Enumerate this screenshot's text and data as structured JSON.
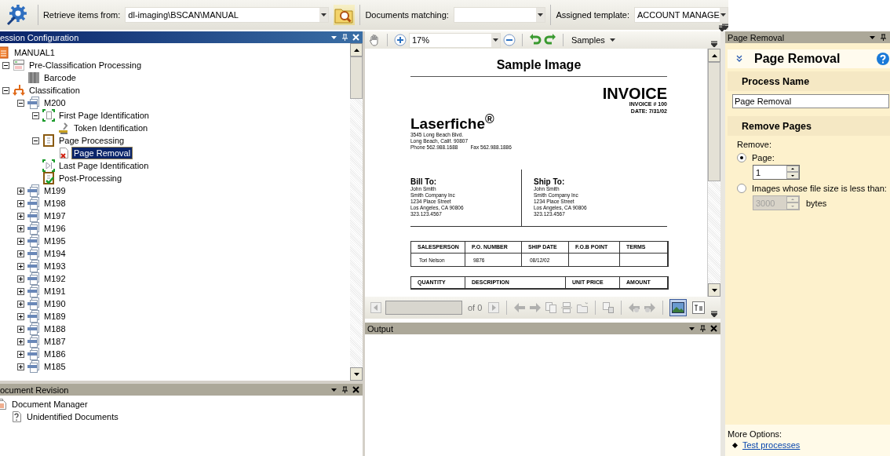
{
  "toolbar": {
    "retrieve_label": "Retrieve items from:",
    "retrieve_value": "dl-imaging\\BSCAN\\MANUAL",
    "matching_label": "Documents matching:",
    "template_label": "Assigned template:",
    "template_value": "ACCOUNT MANAGE"
  },
  "session_panel": {
    "title": "ession Configuration",
    "active": true,
    "tree": [
      {
        "label": "MANUAL1",
        "kind": "session",
        "selected": false,
        "children": [
          {
            "label": "Pre-Classification Processing",
            "kind": "preclass",
            "expanded": true,
            "selected": false,
            "children": [
              {
                "label": "Barcode",
                "kind": "barcode",
                "selected": false
              }
            ]
          },
          {
            "label": "Classification",
            "kind": "classification",
            "expanded": true,
            "selected": false,
            "children": [
              {
                "label": "M200",
                "kind": "doctype",
                "expanded": true,
                "selected": false,
                "children": [
                  {
                    "label": "First Page Identification",
                    "kind": "firstpage",
                    "expanded": true,
                    "selected": false,
                    "children": [
                      {
                        "label": "Token Identification",
                        "kind": "token",
                        "selected": false
                      }
                    ]
                  },
                  {
                    "label": "Page Processing",
                    "kind": "pageproc",
                    "expanded": true,
                    "selected": false,
                    "children": [
                      {
                        "label": "Page Removal",
                        "kind": "removal",
                        "selected": true
                      }
                    ]
                  },
                  {
                    "label": "Last Page Identification",
                    "kind": "lastpage",
                    "selected": false
                  },
                  {
                    "label": "Post-Processing",
                    "kind": "postproc",
                    "selected": false
                  }
                ]
              },
              {
                "label": "M199",
                "kind": "doctype",
                "expanded": false,
                "selected": false
              },
              {
                "label": "M198",
                "kind": "doctype",
                "expanded": false,
                "selected": false
              },
              {
                "label": "M197",
                "kind": "doctype",
                "expanded": false,
                "selected": false
              },
              {
                "label": "M196",
                "kind": "doctype",
                "expanded": false,
                "selected": false
              },
              {
                "label": "M195",
                "kind": "doctype",
                "expanded": false,
                "selected": false
              },
              {
                "label": "M194",
                "kind": "doctype",
                "expanded": false,
                "selected": false
              },
              {
                "label": "M193",
                "kind": "doctype",
                "expanded": false,
                "selected": false
              },
              {
                "label": "M192",
                "kind": "doctype",
                "expanded": false,
                "selected": false
              },
              {
                "label": "M191",
                "kind": "doctype",
                "expanded": false,
                "selected": false
              },
              {
                "label": "M190",
                "kind": "doctype",
                "expanded": false,
                "selected": false
              },
              {
                "label": "M189",
                "kind": "doctype",
                "expanded": false,
                "selected": false
              },
              {
                "label": "M188",
                "kind": "doctype",
                "expanded": false,
                "selected": false
              },
              {
                "label": "M187",
                "kind": "doctype",
                "expanded": false,
                "selected": false
              },
              {
                "label": "M186",
                "kind": "doctype",
                "expanded": false,
                "selected": false
              },
              {
                "label": "M185",
                "kind": "doctype",
                "expanded": false,
                "selected": false
              }
            ]
          }
        ]
      }
    ]
  },
  "revision_panel": {
    "title": "ocument Revision",
    "active": false,
    "tree": [
      {
        "label": "Document Manager",
        "kind": "manager",
        "selected": false,
        "children": [
          {
            "label": "Unidentified Documents",
            "kind": "unknown",
            "selected": false
          }
        ]
      }
    ]
  },
  "viewer": {
    "zoom": "17%",
    "samples_label": "Samples",
    "page_of": "of 0",
    "view_modes": [
      {
        "kind": "image",
        "selected": true
      },
      {
        "kind": "text",
        "selected": false
      }
    ],
    "document": {
      "heading": "Sample Image",
      "title": "INVOICE",
      "logo": "Laserfiche$^{®}$",
      "address": [
        "3545 Long Beach Blvd.",
        "Long Beach, Calif. 90807"
      ],
      "phone": "Phone 562.988.1688",
      "fax": "Fax 562.988.1886",
      "invoice_no": "INVOICE # 100",
      "date": "DATE: 7/31/02",
      "bill_to": {
        "heading": "Bill To:",
        "lines": [
          "John Smith",
          "Smith Company Inc",
          "1234  Place Street",
          "Los Angeles, CA  90806",
          "323.123.4567"
        ]
      },
      "ship_to": {
        "heading": "Ship To:",
        "lines": [
          "John Smith",
          "Smith Company Inc",
          "1234  Place Street",
          "Los Angeles, CA  90806",
          "323.123.4567"
        ]
      },
      "order_table": {
        "columns": [
          "SALESPERSON",
          "P.O. NUMBER",
          "SHIP DATE",
          "F.O.B POINT",
          "TERMS"
        ],
        "rows": [
          [
            "Tori Nelson",
            "9876",
            "08/12/02"
          ]
        ]
      },
      "items_table": {
        "columns": [
          "QUANTITY",
          "DESCRIPTION",
          "UNIT PRICE",
          "AMOUNT"
        ]
      }
    }
  },
  "output_panel": {
    "title": "Output",
    "active": false
  },
  "properties_panel": {
    "title": "Page Removal",
    "heading": "Page Removal",
    "process_name": {
      "title": "Process Name",
      "value": "Page Removal"
    },
    "remove_pages": {
      "title": "Remove Pages",
      "label": "Remove:",
      "options": [
        {
          "label": "Page:",
          "selected": true,
          "spin_value": "1"
        },
        {
          "label": "Images whose file size is less than:",
          "selected": false,
          "spin_value": "3000",
          "unit": "bytes"
        }
      ]
    },
    "more_options": {
      "label": "More Options:",
      "links": [
        "Test processes"
      ]
    }
  }
}
